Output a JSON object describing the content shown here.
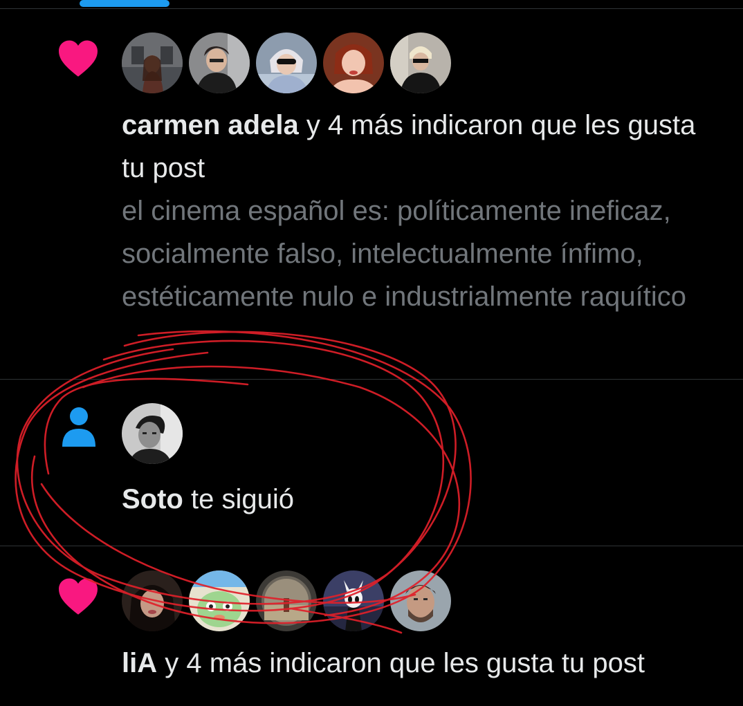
{
  "colors": {
    "background": "#000000",
    "accent": "#1d9bf0",
    "heart": "#f91880",
    "text_primary": "#e7e9ea",
    "text_secondary": "#71767b",
    "divider": "#2f3336",
    "annotation": "#e0202a"
  },
  "notifications": [
    {
      "type": "like",
      "icon": "heart-icon",
      "actor": "carmen adela",
      "action": " y 4 más indicaron que les gusta tu post",
      "post_text": "el cinema español es: políticamente ineficaz, socialmente falso, intelectualmente ínfimo, estéticamente nulo e industrialmente raquítico",
      "avatar_count": 5
    },
    {
      "type": "follow",
      "icon": "person-icon",
      "actor": "Soto",
      "action": " te siguió",
      "avatar_count": 1
    },
    {
      "type": "like",
      "icon": "heart-icon",
      "actor": "liA",
      "action": " y 4 más indicaron que les gusta tu post",
      "avatar_count": 5
    }
  ]
}
